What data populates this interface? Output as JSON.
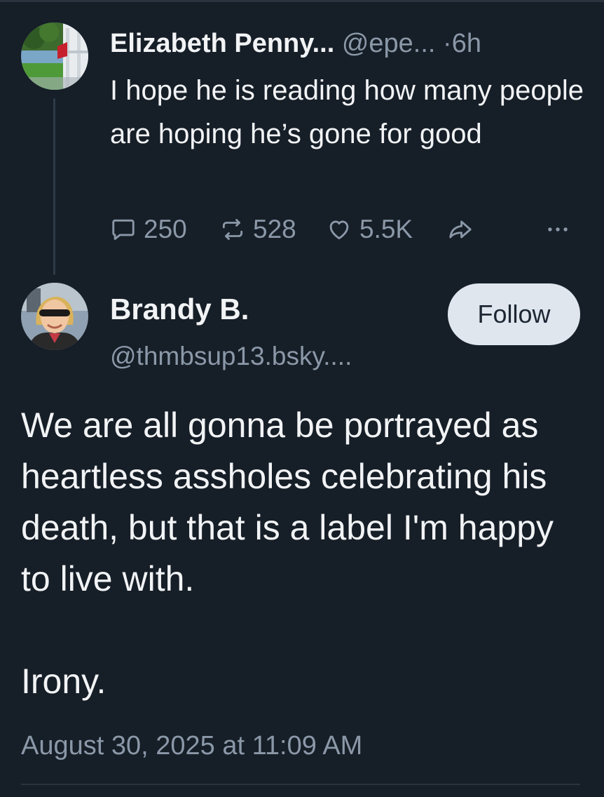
{
  "parent_post": {
    "author_name": "Elizabeth Penny...",
    "author_handle": "@epe...",
    "separator": "·",
    "time_ago": "6h",
    "text": "I hope he is reading how many people are hoping he’s gone for good",
    "reply_count": "250",
    "repost_count": "528",
    "like_count": "5.5K",
    "icons": [
      "reply-icon",
      "repost-icon",
      "like-icon",
      "share-icon",
      "more-icon"
    ]
  },
  "main_post": {
    "author_name": "Brandy B.",
    "author_handle": "@thmbsup13.bsky....",
    "follow_label": "Follow",
    "text_paragraph_1": "We are all gonna be portrayed as heartless assholes celebrating his death, but that is a label I'm happy to live with.",
    "text_paragraph_2": "Irony.",
    "timestamp": "August 30, 2025 at 11:09 AM"
  },
  "colors": {
    "background": "#161e27",
    "text_primary": "#f1f3f5",
    "text_secondary": "#8b98a8",
    "follow_button_bg": "#dfe6ee",
    "thread_line": "#2e3a48"
  }
}
